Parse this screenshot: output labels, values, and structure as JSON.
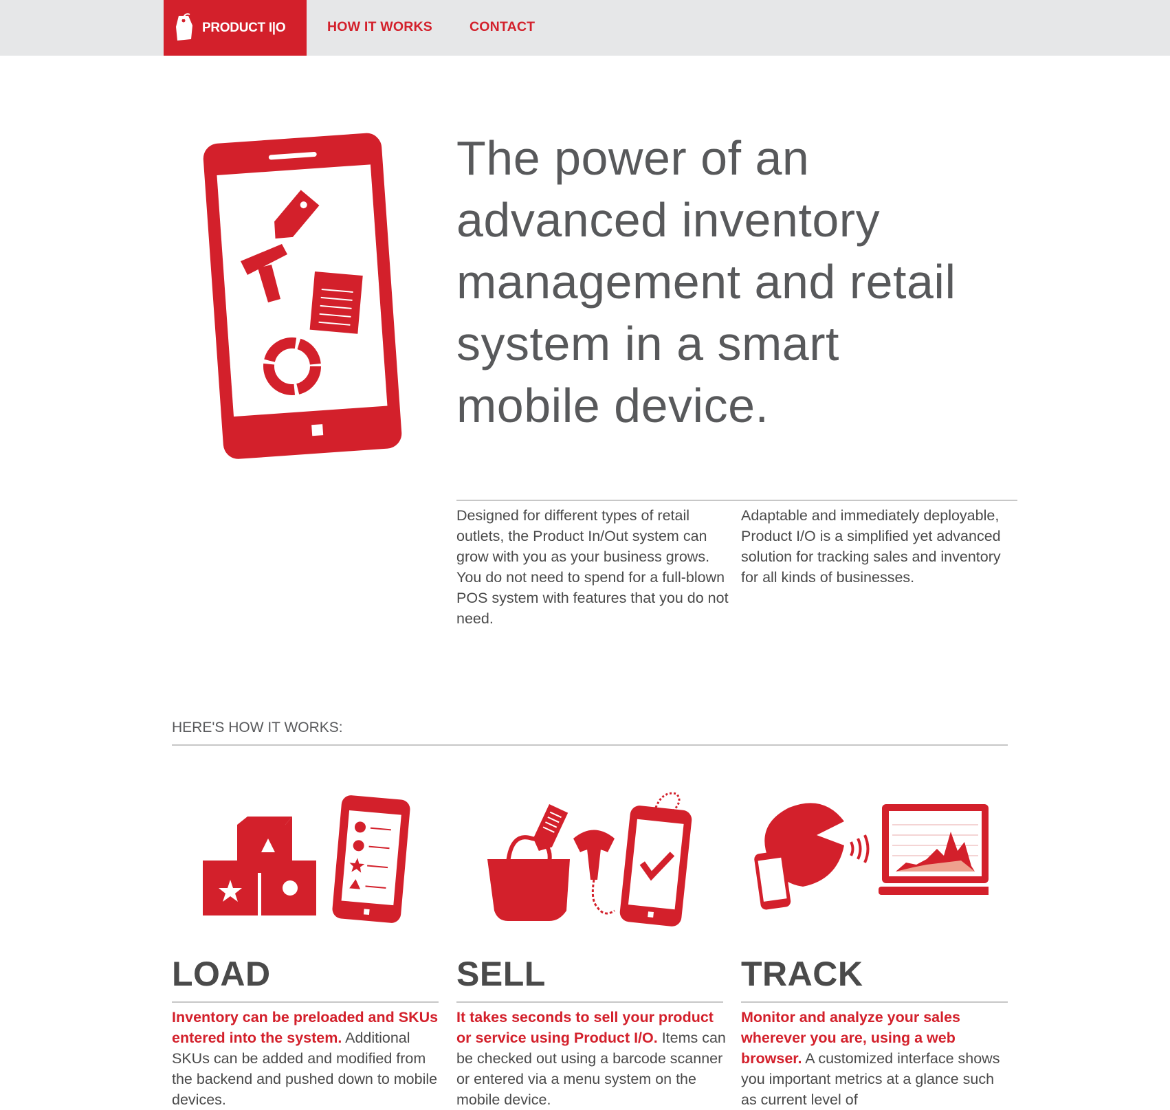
{
  "nav": {
    "brand_label": "PRODUCT I|O",
    "brand_icon": "price-tag-icon",
    "links": [
      {
        "label": "HOW IT WORKS"
      },
      {
        "label": "CONTACT"
      }
    ]
  },
  "hero": {
    "headline": "The power of an advanced inventory management and retail system in a smart mobile device.",
    "illustration_icon": "smartphone-inventory-icon",
    "intro_left": "Designed for different types of retail outlets, the Product In/Out system can grow with you as your business grows. You do not need to spend for a full-blown POS system with features that you do not need.",
    "intro_right": "Adaptable and immediately deployable, Product I/O is a simplified yet advanced solution for tracking sales and inventory for all kinds of businesses."
  },
  "how": {
    "heading": "HERE'S HOW IT WORKS:",
    "columns": [
      {
        "title": "LOAD",
        "icon": "blocks-and-phone-icon",
        "lead": "Inventory can be preloaded and SKUs entered into the system.",
        "body": " Additional SKUs can be added and modified from the backend and pushed down to mobile devices."
      },
      {
        "title": "SELL",
        "icon": "bag-scanner-phone-icon",
        "lead": "It takes seconds to sell your product or service using Product I/O.",
        "body": " Items can be checked out using a barcode scanner or entered via a menu system on the mobile device."
      },
      {
        "title": "TRACK",
        "icon": "cloud-laptop-chart-icon",
        "lead": "Monitor and analyze your sales wherever you are, using a web browser.",
        "body": " A customized interface shows you important metrics at a glance such as current level of"
      }
    ]
  },
  "colors": {
    "brand_red": "#d3202b",
    "nav_bg": "#e6e7e8",
    "text_gray": "#58595b"
  }
}
